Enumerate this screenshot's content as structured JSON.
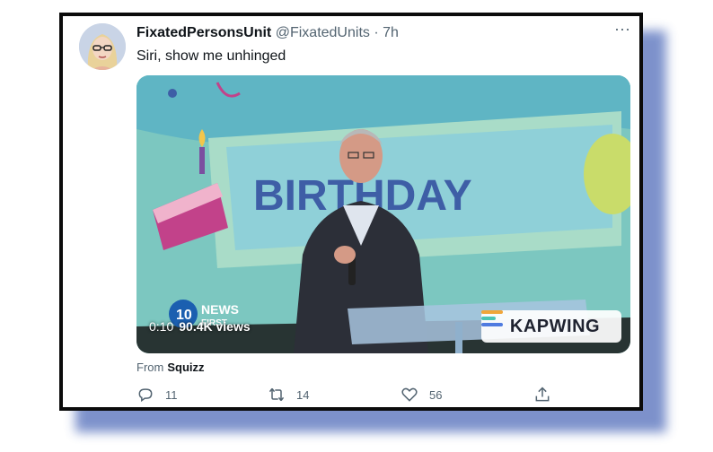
{
  "tweet": {
    "display_name": "FixatedPersonsUnit",
    "handle": "@FixatedUnits",
    "separator": "·",
    "time": "7h",
    "text": "Siri, show me unhinged",
    "more_label": "···"
  },
  "media": {
    "banner_text": "BIRTHDAY",
    "timestamp": "0:10",
    "views": "90.4K views",
    "news_logo": "NEWS",
    "news_logo_sub": "FIRST",
    "watermark": "KAPWING"
  },
  "source": {
    "prefix": "From",
    "name": "Squizz"
  },
  "actions": {
    "reply_count": "11",
    "retweet_count": "14",
    "like_count": "56"
  },
  "colors": {
    "frame": "#0b0b0b",
    "shadow": "#6f86c6",
    "text_primary": "#0f1419",
    "text_secondary": "#536471",
    "video_bg": "#7cc7c0"
  }
}
